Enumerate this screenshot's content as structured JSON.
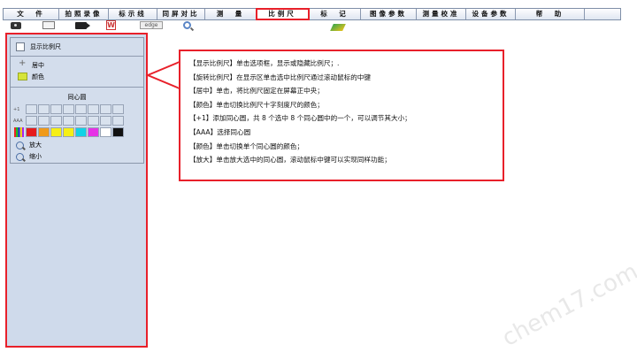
{
  "menu": {
    "items": [
      {
        "label": "文　件",
        "width": 63
      },
      {
        "label": "拍照录像",
        "width": 56
      },
      {
        "label": "标示线",
        "width": 55
      },
      {
        "label": "同屏对比",
        "width": 54
      },
      {
        "label": "测　量",
        "width": 58
      },
      {
        "label": "比例尺",
        "width": 59,
        "active": true
      },
      {
        "label": "标　记",
        "width": 59
      },
      {
        "label": "图像参数",
        "width": 63
      },
      {
        "label": "测量校准",
        "width": 56
      },
      {
        "label": "设备参数",
        "width": 56
      },
      {
        "label": "帮　助",
        "width": 78
      }
    ]
  },
  "toolbar": {
    "icons": [
      "camera-icon",
      "window-icon",
      "video-icon",
      "word-icon",
      "edge-icon",
      "zoom-icon",
      "ruler-icon"
    ],
    "edge_label": "edge",
    "word_label": "W"
  },
  "panel": {
    "show_ruler": "显示比例尺",
    "center": "居中",
    "color": "颜色",
    "concentric": "同心圆",
    "plus_one": "+1",
    "aaa": "AAA",
    "zoom_in": "放大",
    "zoom_out": "缩小",
    "swatches": [
      "#e61c1c",
      "#f09a1a",
      "#f5ef16",
      "#f5ef16",
      "#12d2e6",
      "#e632e6",
      "#ffffff",
      "#111111"
    ]
  },
  "callout": {
    "lines": [
      "【显示比例尺】单击选项框，显示或隐藏比例尺；.",
      "【旋转比例尺】在显示区单击选中比例尺通过滚动鼠标的中键",
      "【居中】单击，将比例尺固定在屏幕正中央；",
      "【颜色】单击切换比例尺十字刻度尺的颜色；",
      "【+1】添加同心圆，共 8 个选中 8 个同心圆中的一个，可以调节其大小；",
      "【AAA】选择同心圆",
      "【颜色】单击切换单个同心圆的颜色；",
      "【放大】单击放大选中的同心圆，滚动鼠标中键可以实现同样功能；"
    ]
  },
  "watermark": "chem17.com",
  "colors": {
    "accent_red": "#e8202a",
    "panel_bg": "#cfdaeb"
  }
}
